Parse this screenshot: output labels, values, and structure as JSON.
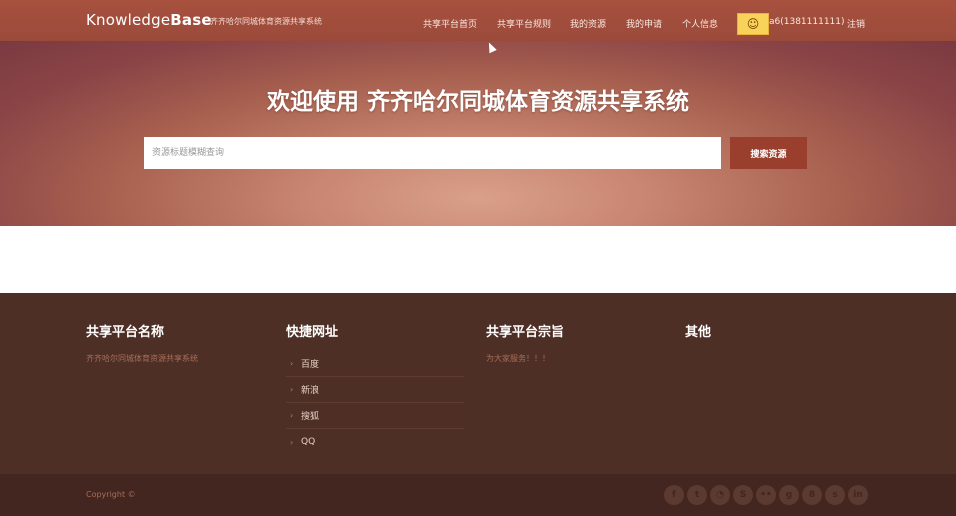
{
  "header": {
    "brand_part1": "Knowledge",
    "brand_part2": "Base",
    "subbrand": "齐齐哈尔同城体育资源共享系统",
    "nav": [
      {
        "label": "共享平台首页"
      },
      {
        "label": "共享平台规则"
      },
      {
        "label": "我的资源"
      },
      {
        "label": "我的申请"
      },
      {
        "label": "个人信息"
      }
    ],
    "user": "a6(1381111111)",
    "logout": "注销"
  },
  "hero": {
    "title": "欢迎使用 齐齐哈尔同城体育资源共享系统",
    "search_placeholder": "资源标题模糊查询",
    "search_value": "",
    "search_button": "搜索资源"
  },
  "footer": {
    "col1_title": "共享平台名称",
    "col1_text": "齐齐哈尔同城体育资源共享系统",
    "col2_title": "快捷网址",
    "links": [
      {
        "label": "百度"
      },
      {
        "label": "新浪"
      },
      {
        "label": "搜狐"
      },
      {
        "label": "QQ"
      }
    ],
    "col3_title": "共享平台宗旨",
    "col3_text": "为大家服务！！！",
    "col4_title": "其他",
    "copyright": "Copyright ©",
    "social_icons": [
      "facebook-icon",
      "twitter-icon",
      "rss-icon",
      "skype-icon",
      "flickr-icon",
      "google-plus-icon",
      "odnoklassniki-icon",
      "stumbleupon-icon",
      "linkedin-icon"
    ]
  },
  "colors": {
    "topbar": "#a8513f",
    "footer": "#4d2f26",
    "bottombar": "#42261f",
    "search_button": "#9a3f2d"
  }
}
